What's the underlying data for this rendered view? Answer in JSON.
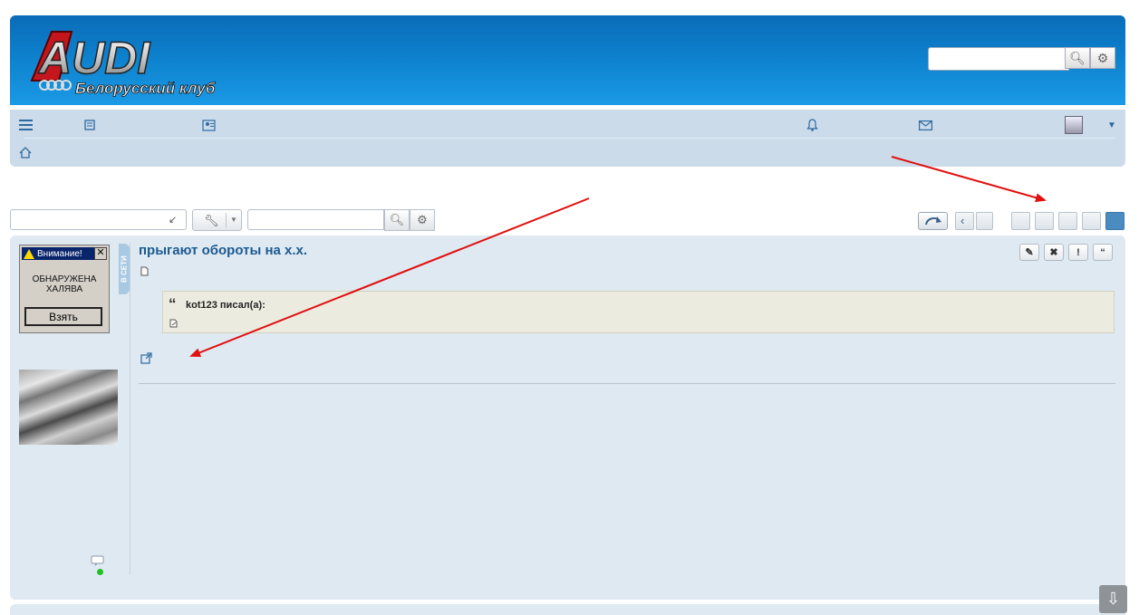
{
  "header": {
    "logo_text": "AUDI",
    "logo_subtitle": "Белорусский клуб",
    "search": {
      "value": "",
      "placeholder": ""
    }
  },
  "toolbar": {
    "search": {
      "value": "",
      "placeholder": ""
    }
  },
  "promo": {
    "title": "Внимание!",
    "close": "✕",
    "message_line1": "ОБНАРУЖЕНА",
    "message_line2": "ХАЛЯВА",
    "button": "Взять"
  },
  "post": {
    "online_badge": "В СЕТИ",
    "title": "прыгают обороты на х.х.",
    "quote": {
      "author": "kot123 писал(а):"
    }
  },
  "colors": {
    "header_blue": "#0d80cc",
    "nav_bg": "#cbdbea",
    "panel_bg": "#dfe9f1",
    "quote_bg": "#ecebe0",
    "title_blue": "#1c5a91",
    "arrow_red": "#e01010",
    "active_page": "#4a8cc0"
  },
  "icons": {
    "nav": [
      "menu-icon",
      "board-icon",
      "members-icon",
      "bell-icon",
      "mail-icon",
      "avatar",
      "dropdown-caret-icon"
    ],
    "toolbar": [
      "collapse-arrow-icon",
      "wrench-icon",
      "search-icon",
      "gear-icon",
      "reply-arrow-icon",
      "chevron-left-icon"
    ],
    "post_actions": [
      "edit-icon",
      "delete-icon",
      "report-icon",
      "quote-icon"
    ]
  }
}
